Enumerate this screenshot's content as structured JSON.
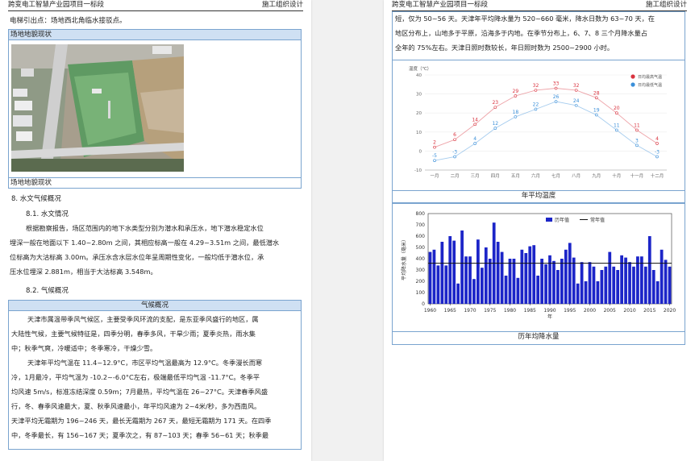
{
  "header": {
    "left": "跨变电工智慧产业园项目一标段",
    "right": "施工组织设计"
  },
  "left": {
    "intro": "电梯引出点：场地西北角临水接驳点。",
    "site_caption_top": "场地地貌现状",
    "site_caption_bottom": "场地地貌现状",
    "sec8": "8. 水文气候概况",
    "sec81": "8.1. 水文情况",
    "hydro": [
      "根据勘察报告，场区范围内的地下水类型分别为潜水和承压水，地下潜水稳定水位",
      "埋深一般在地面以下 1.40~2.80m 之间，其相应标高一般在 4.29~3.51m 之间，最低潜水",
      "位标高为大沽标高 3.00m。承压水含水层水位年呈周期性变化，一般均低于潜水位，承",
      "压水位埋深 2.881m，相当于大沽标高 3.548m。"
    ],
    "sec82": "8.2. 气候概况",
    "climate_title": "气候概况",
    "climate": [
      "天津市属温带季风气候区，主要受季风环流的支配，是东亚季风盛行的地区，属",
      "大陆性气候，主要气候特征是，四季分明，春季多风，干旱少雨；夏季炎热，雨水集",
      "中；秋季气爽，冷暖适中；冬季寒冷，干燥少雪。",
      "天津年平均气温在 11.4~12.9°C，市区平均气温最高为 12.9°C。冬季漫长而寒",
      "冷，1月最冷，平均气温为 -10.2~-6.0°C左右，极端最低平均气温 -11.7°C。冬季平",
      "均风速 5m/s，标准冻结深度 0.59m；7月最热，平均气温在 26~27°C。天津春季风盛",
      "行，冬、春季风速最大，夏、秋季风速最小，年平均风速为 2~4米/秒，多为西南风。",
      "天津平均无霜期为 196~246 天，最长无霜期为 267 天，最短无霜期为 171 天。在四季",
      "中，冬季最长，有 156~167 天；夏季次之，有 87~103 天；春季 56~61 天；秋季最"
    ]
  },
  "right": {
    "text": [
      "短，仅为 50~56 天。天津年平均降水量为 520~660 毫米，降水日数为 63~70 天，在",
      "地区分布上，山地多于平原，沿海多于内地。在季节分布上，6、7、8 三个月降水量占",
      "全年的 75%左右。天津日照时数较长，年日照时数为 2500~2900 小时。"
    ],
    "temp_caption": "年平均温度",
    "precip_caption": "历年均降水量"
  },
  "chart_data": [
    {
      "type": "line",
      "ylabel": "温度（℃）",
      "categories": [
        "一月",
        "二月",
        "三月",
        "四月",
        "五月",
        "六月",
        "七月",
        "八月",
        "九月",
        "十月",
        "十一月",
        "十二月"
      ],
      "ylim": [
        -10,
        40
      ],
      "yticks": [
        -10,
        0,
        10,
        20,
        30,
        40
      ],
      "legend": "top-right",
      "series": [
        {
          "name": "日均最高气温",
          "color": "#d9333f",
          "values": [
            2,
            6,
            14,
            23,
            29,
            32,
            33,
            32,
            28,
            20,
            11,
            4
          ]
        },
        {
          "name": "日均最低气温",
          "color": "#3a8fd9",
          "values": [
            -5,
            -3,
            4,
            12,
            18,
            22,
            26,
            24,
            19,
            11,
            3,
            -3
          ]
        }
      ]
    },
    {
      "type": "bar",
      "ylabel": "平均降水量（毫米）",
      "xlabel": "年",
      "ylim": [
        0,
        800
      ],
      "yticks": [
        0,
        100,
        200,
        300,
        400,
        500,
        600,
        700,
        800
      ],
      "xticks": [
        "1960",
        "1965",
        "1970",
        "1975",
        "1980",
        "1985",
        "1990",
        "1995",
        "2000",
        "2005",
        "2010",
        "2015",
        "2020"
      ],
      "legend": "top",
      "series": [
        {
          "name": "历年值",
          "color": "#1c25c8",
          "years": [
            1960,
            1961,
            1962,
            1963,
            1964,
            1965,
            1966,
            1967,
            1968,
            1969,
            1970,
            1971,
            1972,
            1973,
            1974,
            1975,
            1976,
            1977,
            1978,
            1979,
            1980,
            1981,
            1982,
            1983,
            1984,
            1985,
            1986,
            1987,
            1988,
            1989,
            1990,
            1991,
            1992,
            1993,
            1994,
            1995,
            1996,
            1997,
            1998,
            1999,
            2000,
            2001,
            2002,
            2003,
            2004,
            2005,
            2006,
            2007,
            2008,
            2009,
            2010,
            2011,
            2012,
            2013,
            2014,
            2015,
            2016,
            2017,
            2018,
            2019,
            2020
          ],
          "values": [
            460,
            480,
            340,
            550,
            340,
            600,
            560,
            180,
            650,
            420,
            420,
            220,
            570,
            320,
            500,
            400,
            720,
            550,
            460,
            250,
            400,
            400,
            230,
            480,
            450,
            510,
            520,
            250,
            400,
            350,
            430,
            380,
            300,
            400,
            480,
            540,
            410,
            180,
            370,
            200,
            370,
            330,
            200,
            300,
            330,
            460,
            330,
            300,
            430,
            410,
            370,
            330,
            420,
            420,
            330,
            600,
            300,
            200,
            480,
            390,
            330
          ]
        },
        {
          "name": "常年值",
          "color": "#111111",
          "values": [
            360
          ]
        }
      ]
    }
  ]
}
